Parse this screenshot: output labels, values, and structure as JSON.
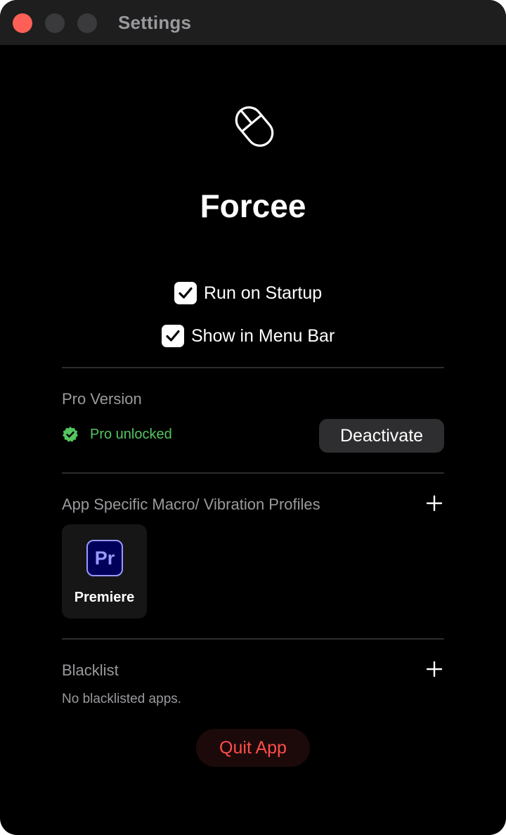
{
  "window": {
    "title": "Settings"
  },
  "app": {
    "name": "Forcee",
    "icon": "mouse-icon"
  },
  "options": [
    {
      "label": "Run on Startup",
      "checked": true
    },
    {
      "label": "Show in Menu Bar",
      "checked": true
    }
  ],
  "pro": {
    "section_title": "Pro Version",
    "status": "Pro unlocked",
    "status_color": "#54c55f",
    "button": "Deactivate"
  },
  "profiles": {
    "section_title": "App Specific Macro/ Vibration Profiles",
    "items": [
      {
        "icon_text": "Pr",
        "name": "Premiere"
      }
    ]
  },
  "blacklist": {
    "section_title": "Blacklist",
    "empty_text": "No blacklisted apps."
  },
  "quit": {
    "label": "Quit App",
    "color": "#ff4d4a"
  }
}
